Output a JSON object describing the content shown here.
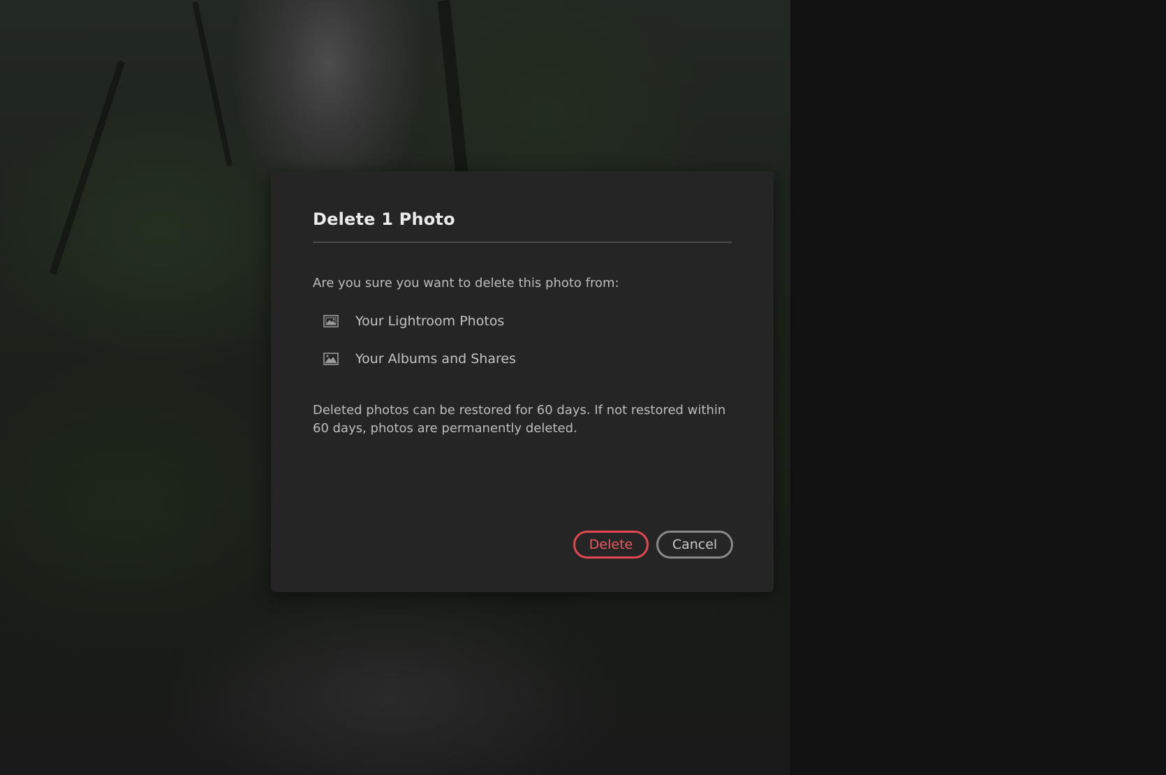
{
  "dialog": {
    "title": "Delete 1 Photo",
    "prompt": "Are you sure you want to delete this photo from:",
    "locations": [
      {
        "label": "Your Lightroom Photos",
        "icon": "photo-icon"
      },
      {
        "label": "Your Albums and Shares",
        "icon": "photo-album-icon"
      }
    ],
    "note": "Deleted photos can be restored for 60 days. If not restored within 60 days, photos are permanently deleted.",
    "buttons": {
      "delete_label": "Delete",
      "cancel_label": "Cancel"
    }
  },
  "colors": {
    "dialog_background": "#252525",
    "delete_accent": "#e34850",
    "cancel_border": "#8a8a8a",
    "text_primary": "#ebebeb",
    "text_secondary": "#bdbdbd"
  }
}
